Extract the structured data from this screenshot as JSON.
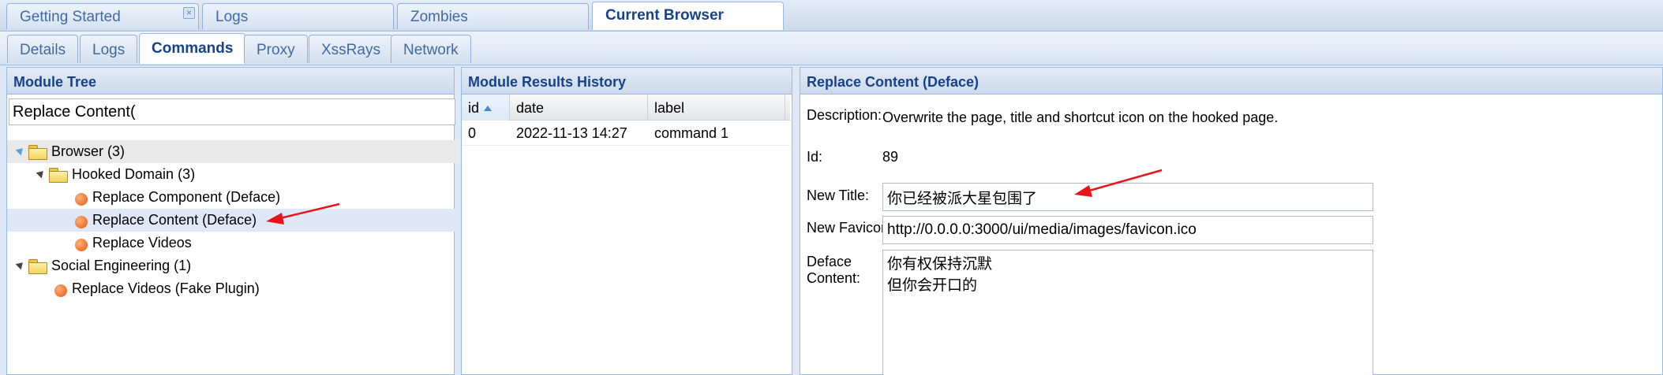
{
  "top_tabs": [
    {
      "label": "Getting Started",
      "close": "×"
    },
    {
      "label": "Logs"
    },
    {
      "label": "Zombies"
    },
    {
      "label": "Current Browser"
    }
  ],
  "sub_tabs": [
    "Details",
    "Logs",
    "Commands",
    "Proxy",
    "XssRays",
    "Network"
  ],
  "module_tree": {
    "title": "Module Tree",
    "search_value": "Replace Content(",
    "nodes": [
      {
        "label": "Browser (3)"
      },
      {
        "label": "Hooked Domain (3)"
      },
      {
        "label": "Replace Component (Deface)"
      },
      {
        "label": "Replace Content (Deface)"
      },
      {
        "label": "Replace Videos"
      },
      {
        "label": "Social Engineering (1)"
      },
      {
        "label": "Replace Videos (Fake Plugin)"
      }
    ]
  },
  "results": {
    "title": "Module Results History",
    "columns": [
      "id",
      "date",
      "label"
    ],
    "rows": [
      {
        "id": "0",
        "date": "2022-11-13 14:27",
        "label": "command 1"
      }
    ]
  },
  "detail": {
    "title": "Replace Content (Deface)",
    "description_label": "Description:",
    "description": "Overwrite the page, title and shortcut icon on the hooked page.",
    "id_label": "Id:",
    "id_value": "89",
    "new_title_label": "New Title:",
    "new_title": "你已经被派大星包围了",
    "new_favicon_label": "New Favicon:",
    "new_favicon": "http://0.0.0.0:3000/ui/media/images/favicon.ico",
    "deface_label_1": "Deface",
    "deface_label_2": "Content:",
    "deface_content": "你有权保持沉默\n但你会开口的"
  },
  "colors": {
    "annotation_arrow": "#e8141b",
    "header_text": "#15428b",
    "selected_row": "#dfe8f6"
  }
}
